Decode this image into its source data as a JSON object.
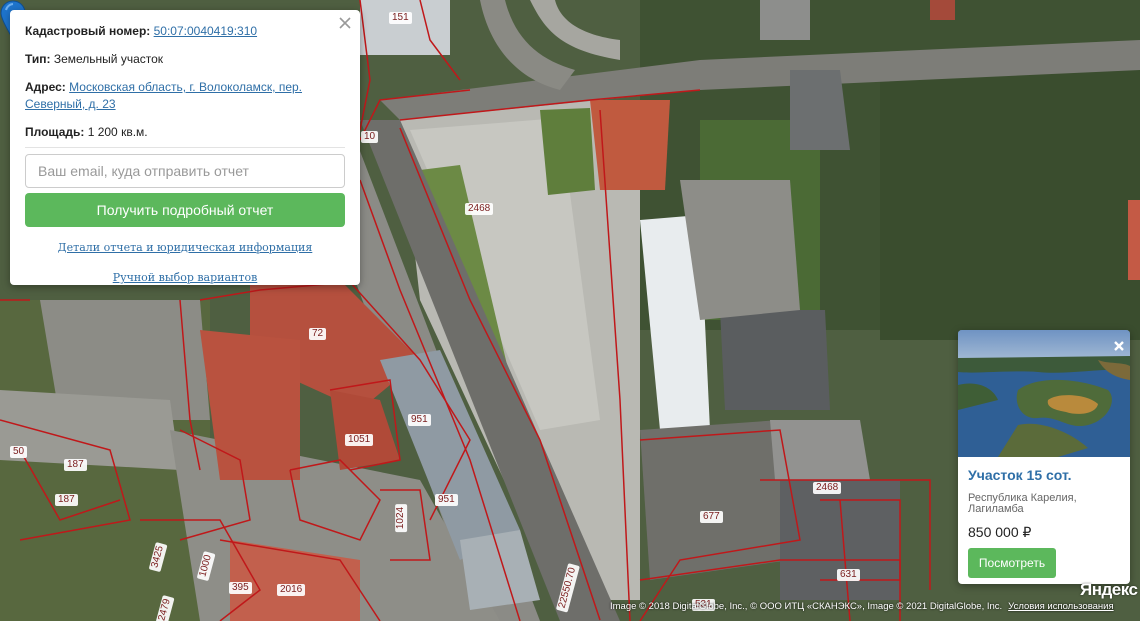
{
  "info_popup": {
    "cadastral_label": "Кадастровый номер:",
    "cadastral_value": "50:07:0040419:310",
    "type_label": "Тип:",
    "type_value": "Земельный участок",
    "address_label": "Адрес:",
    "address_value": "Московская область, г. Волоколамск, пер. Северный, д. 23",
    "area_label": "Площадь:",
    "area_value": "1 200 кв.м.",
    "email_placeholder": "Ваш email, куда отправить отчет",
    "email_value": "",
    "report_button": "Получить подробный отчет",
    "details_link": "Детали отчета и юридическая информация",
    "manual_link": "Ручной выбор вариантов"
  },
  "ad_card": {
    "title": "Участок 15 сот.",
    "location": "Республика Карелия, Лагиламба",
    "price": "850 000 ₽",
    "button": "Посмотреть"
  },
  "parcel_labels": [
    "151",
    "10",
    "2468",
    "72",
    "951",
    "1051",
    "951",
    "1024",
    "50",
    "187",
    "187",
    "3425",
    "1000",
    "395",
    "2016",
    "2479",
    "22550.70",
    "531",
    "677",
    "2468",
    "631"
  ],
  "copyright": {
    "text": "Image © 2018 DigitalGlobe, Inc., © ООО ИТЦ «СКАНЭКС», Image © 2021 DigitalGlobe, Inc.",
    "terms": "Условия использования",
    "logo": "Яндекс"
  },
  "colors": {
    "accent_green": "#5cb85c",
    "link_blue": "#2f6fa7",
    "parcel_border": "#c0181a",
    "pin_blue": "#1e74cc"
  },
  "icons": {
    "popup_close": "close-icon",
    "ad_close": "close-icon",
    "marker": "map-pin-icon"
  }
}
